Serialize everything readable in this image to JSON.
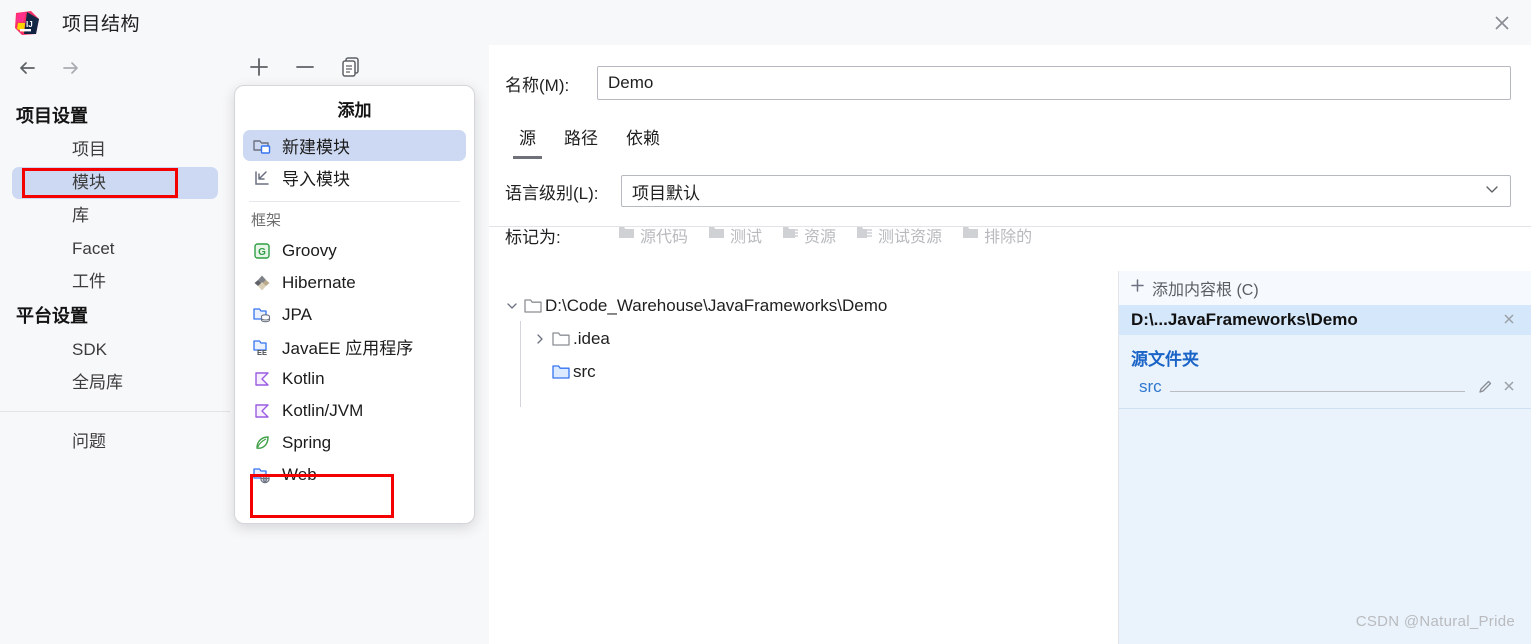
{
  "window": {
    "title": "项目结构",
    "app_icon": "intellij-idea-icon",
    "close_label": "✕"
  },
  "sidebar": {
    "back_icon": "arrow-left-icon",
    "forward_icon": "arrow-right-icon",
    "groups": [
      {
        "label": "项目设置",
        "items": [
          {
            "label": "项目",
            "selected": false
          },
          {
            "label": "模块",
            "selected": true
          },
          {
            "label": "库",
            "selected": false
          },
          {
            "label": "Facet",
            "selected": false
          },
          {
            "label": "工件",
            "selected": false
          }
        ]
      },
      {
        "label": "平台设置",
        "items": [
          {
            "label": "SDK",
            "selected": false
          },
          {
            "label": "全局库",
            "selected": false
          }
        ]
      }
    ],
    "problems_label": "问题"
  },
  "module_toolbar": {
    "add_label": "+",
    "remove_label": "−",
    "copy_label": "copy-icon"
  },
  "add_popup": {
    "title": "添加",
    "items": [
      {
        "label": "新建模块",
        "icon": "new-module-folder-icon",
        "selected": true
      },
      {
        "label": "导入模块",
        "icon": "import-module-icon",
        "selected": false
      }
    ],
    "section_label": "框架",
    "frameworks": [
      {
        "label": "Groovy",
        "icon": "groovy-icon"
      },
      {
        "label": "Hibernate",
        "icon": "hibernate-icon"
      },
      {
        "label": "JPA",
        "icon": "jpa-icon"
      },
      {
        "label": "JavaEE 应用程序",
        "icon": "javaee-icon"
      },
      {
        "label": "Kotlin",
        "icon": "kotlin-icon"
      },
      {
        "label": "Kotlin/JVM",
        "icon": "kotlin-jvm-icon"
      },
      {
        "label": "Spring",
        "icon": "spring-icon"
      },
      {
        "label": "Web",
        "icon": "web-icon"
      }
    ]
  },
  "main": {
    "name_label": "名称(M):",
    "name_value": "Demo",
    "tabs": [
      {
        "label": "源",
        "active": true
      },
      {
        "label": "路径",
        "active": false
      },
      {
        "label": "依赖",
        "active": false
      }
    ],
    "language_label": "语言级别(L):",
    "language_value": "项目默认",
    "mark_as_label": "标记为:",
    "mark_buttons": [
      {
        "label": "源代码",
        "icon": "folder-sources-icon"
      },
      {
        "label": "测试",
        "icon": "folder-tests-icon"
      },
      {
        "label": "资源",
        "icon": "folder-resources-icon"
      },
      {
        "label": "测试资源",
        "icon": "folder-test-resources-icon"
      },
      {
        "label": "排除的",
        "icon": "folder-excluded-icon"
      }
    ],
    "tree": [
      {
        "label": "D:\\Code_Warehouse\\JavaFrameworks\\Demo",
        "depth": 0,
        "state": "expanded",
        "icon": "folder-icon"
      },
      {
        "label": ".idea",
        "depth": 1,
        "state": "collapsed",
        "icon": "folder-icon"
      },
      {
        "label": "src",
        "depth": 1,
        "state": "leaf",
        "icon": "folder-source-icon"
      }
    ],
    "content_roots": {
      "add_label": "添加内容根 (C)",
      "add_icon": "plus-icon",
      "root_path": "D:\\...JavaFrameworks\\Demo",
      "root_remove_icon": "close-icon",
      "source_folders_label": "源文件夹",
      "source_folders": [
        {
          "name": "src",
          "edit_icon": "pencil-icon",
          "remove_icon": "close-icon"
        }
      ]
    }
  },
  "watermark": "CSDN @Natural_Pride",
  "colors": {
    "selection_blue": "#cdd9f2",
    "annotation_red": "#f40000",
    "root_row_blue": "#d5e8fb",
    "roots_pane_blue": "#eaf3fc",
    "link_blue": "#2f78cf"
  }
}
